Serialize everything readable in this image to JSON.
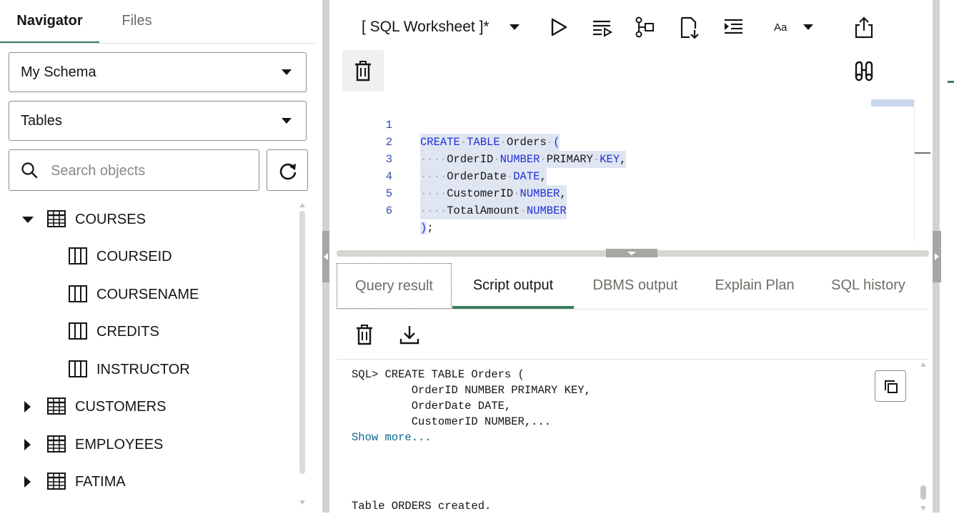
{
  "left_panel": {
    "tabs": [
      {
        "label": "Navigator",
        "active": true
      },
      {
        "label": "Files",
        "active": false
      }
    ],
    "schema_select": {
      "value": "My Schema"
    },
    "object_type_select": {
      "value": "Tables"
    },
    "search": {
      "placeholder": "Search objects",
      "value": ""
    },
    "tree": [
      {
        "label": "COURSES",
        "kind": "table",
        "expanded": true,
        "icon": "table-icon"
      },
      {
        "label": "COURSEID",
        "kind": "column",
        "icon": "column-icon"
      },
      {
        "label": "COURSENAME",
        "kind": "column",
        "icon": "column-icon"
      },
      {
        "label": "CREDITS",
        "kind": "column",
        "icon": "column-icon"
      },
      {
        "label": "INSTRUCTOR",
        "kind": "column",
        "icon": "column-icon"
      },
      {
        "label": "CUSTOMERS",
        "kind": "table",
        "expanded": false,
        "icon": "table-icon"
      },
      {
        "label": "EMPLOYEES",
        "kind": "table",
        "expanded": false,
        "icon": "table-icon"
      },
      {
        "label": "FATIMA",
        "kind": "table",
        "expanded": false,
        "icon": "table-icon"
      }
    ]
  },
  "editor": {
    "worksheet_title": "[ SQL Worksheet ]*",
    "toolbar_icons": [
      "run-statement-icon",
      "run-script-icon",
      "explain-plan-icon",
      "autotrace-icon",
      "format-icon",
      "text-case-icon",
      "share-icon",
      "clear-icon",
      "find-icon"
    ],
    "case_label": "Aa",
    "lines": [
      {
        "n": "1",
        "text": "CREATE TABLE Orders ("
      },
      {
        "n": "2",
        "text": "    OrderID NUMBER PRIMARY KEY,"
      },
      {
        "n": "3",
        "text": "    OrderDate DATE,"
      },
      {
        "n": "4",
        "text": "    CustomerID NUMBER,"
      },
      {
        "n": "5",
        "text": "    TotalAmount NUMBER"
      },
      {
        "n": "6",
        "text": ");"
      }
    ]
  },
  "output": {
    "tabs": [
      {
        "label": "Query result"
      },
      {
        "label": "Script output",
        "active": true
      },
      {
        "label": "DBMS output"
      },
      {
        "label": "Explain Plan"
      },
      {
        "label": "SQL history"
      }
    ],
    "lines": [
      "SQL> CREATE TABLE Orders (",
      "         OrderID NUMBER PRIMARY KEY,",
      "         OrderDate DATE,",
      "         CustomerID NUMBER,..."
    ],
    "show_more": "Show more...",
    "result": "Table ORDERS created."
  },
  "colors": {
    "accent": "#3a7d5e",
    "keyword": "#1f2fd8",
    "line_number": "#2e4fa8",
    "link": "#0d6a8d"
  }
}
